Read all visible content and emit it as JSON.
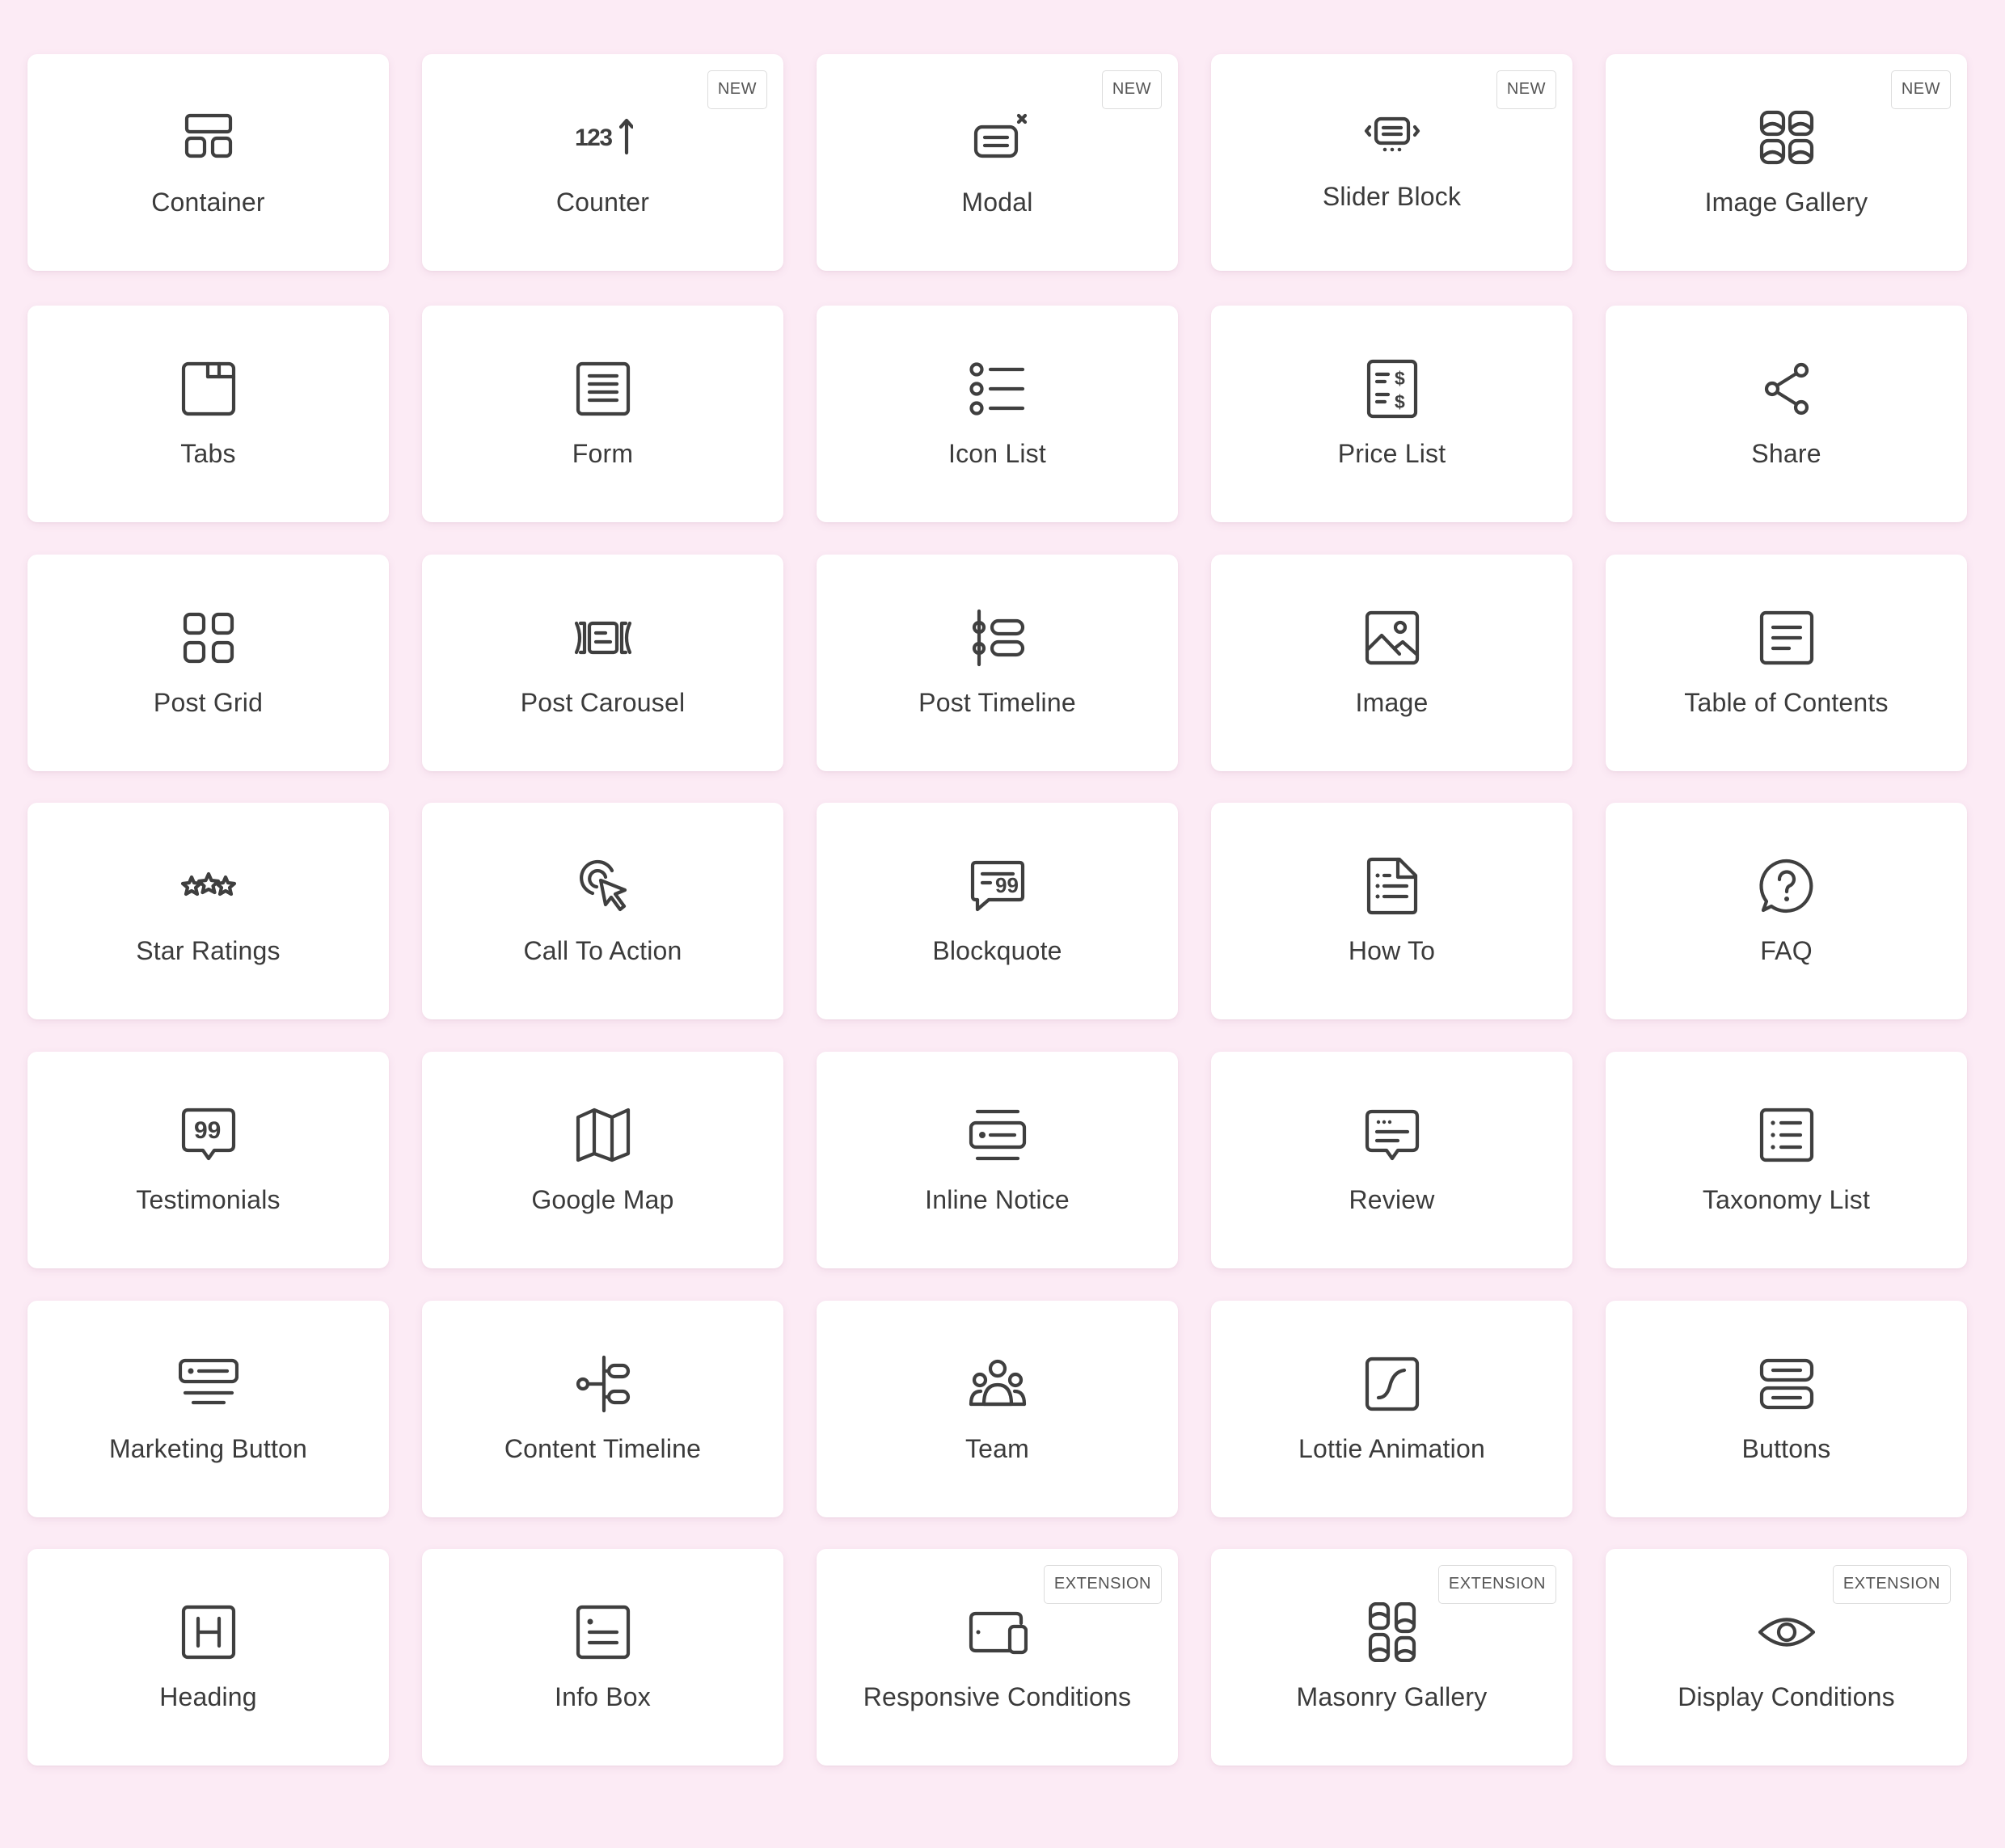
{
  "blocks": [
    {
      "label": "Container",
      "icon": "container-icon",
      "badge": ""
    },
    {
      "label": "Counter",
      "icon": "counter-icon",
      "badge": "NEW"
    },
    {
      "label": "Modal",
      "icon": "modal-icon",
      "badge": "NEW"
    },
    {
      "label": "Slider Block",
      "icon": "slider-icon",
      "badge": "NEW"
    },
    {
      "label": "Image Gallery",
      "icon": "image-gallery-icon",
      "badge": "NEW"
    },
    {
      "label": "Tabs",
      "icon": "tabs-icon",
      "badge": ""
    },
    {
      "label": "Form",
      "icon": "form-icon",
      "badge": ""
    },
    {
      "label": "Icon List",
      "icon": "icon-list-icon",
      "badge": ""
    },
    {
      "label": "Price List",
      "icon": "price-list-icon",
      "badge": ""
    },
    {
      "label": "Share",
      "icon": "share-icon",
      "badge": ""
    },
    {
      "label": "Post Grid",
      "icon": "post-grid-icon",
      "badge": ""
    },
    {
      "label": "Post Carousel",
      "icon": "post-carousel-icon",
      "badge": ""
    },
    {
      "label": "Post Timeline",
      "icon": "post-timeline-icon",
      "badge": ""
    },
    {
      "label": "Image",
      "icon": "image-icon",
      "badge": ""
    },
    {
      "label": "Table of Contents",
      "icon": "table-of-contents-icon",
      "badge": ""
    },
    {
      "label": "Star Ratings",
      "icon": "star-ratings-icon",
      "badge": ""
    },
    {
      "label": "Call To Action",
      "icon": "call-to-action-icon",
      "badge": ""
    },
    {
      "label": "Blockquote",
      "icon": "blockquote-icon",
      "badge": ""
    },
    {
      "label": "How To",
      "icon": "how-to-icon",
      "badge": ""
    },
    {
      "label": "FAQ",
      "icon": "faq-icon",
      "badge": ""
    },
    {
      "label": "Testimonials",
      "icon": "testimonials-icon",
      "badge": ""
    },
    {
      "label": "Google Map",
      "icon": "google-map-icon",
      "badge": ""
    },
    {
      "label": "Inline Notice",
      "icon": "inline-notice-icon",
      "badge": ""
    },
    {
      "label": "Review",
      "icon": "review-icon",
      "badge": ""
    },
    {
      "label": "Taxonomy List",
      "icon": "taxonomy-list-icon",
      "badge": ""
    },
    {
      "label": "Marketing Button",
      "icon": "marketing-button-icon",
      "badge": ""
    },
    {
      "label": "Content Timeline",
      "icon": "content-timeline-icon",
      "badge": ""
    },
    {
      "label": "Team",
      "icon": "team-icon",
      "badge": ""
    },
    {
      "label": "Lottie Animation",
      "icon": "lottie-animation-icon",
      "badge": ""
    },
    {
      "label": "Buttons",
      "icon": "buttons-icon",
      "badge": ""
    },
    {
      "label": "Heading",
      "icon": "heading-icon",
      "badge": ""
    },
    {
      "label": "Info Box",
      "icon": "info-box-icon",
      "badge": ""
    },
    {
      "label": "Responsive Conditions",
      "icon": "responsive-conditions-icon",
      "badge": "EXTENSION"
    },
    {
      "label": "Masonry Gallery",
      "icon": "masonry-gallery-icon",
      "badge": "EXTENSION"
    },
    {
      "label": "Display Conditions",
      "icon": "display-conditions-icon",
      "badge": "EXTENSION"
    }
  ],
  "counter_icon_text": "123"
}
